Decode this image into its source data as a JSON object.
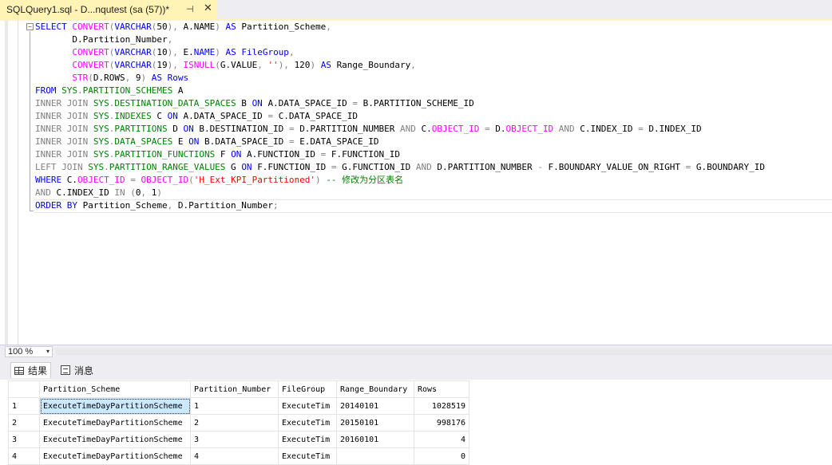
{
  "tab": {
    "title": "SQLQuery1.sql - D...nqutest (sa (57))*",
    "pin_glyph": "⊣",
    "close_glyph": "✕"
  },
  "editor": {
    "fold_glyph": "−",
    "lines": [
      [
        [
          "kw",
          "SELECT "
        ],
        [
          "fn",
          "CONVERT"
        ],
        [
          "gray",
          "("
        ],
        [
          "kw",
          "VARCHAR"
        ],
        [
          "gray",
          "("
        ],
        [
          "id",
          "50"
        ],
        [
          "gray",
          "), "
        ],
        [
          "id",
          "A.NAME"
        ],
        [
          "gray",
          ") "
        ],
        [
          "kw",
          "AS "
        ],
        [
          "id",
          "Partition_Scheme"
        ],
        [
          "gray",
          ","
        ]
      ],
      [
        [
          "id",
          "       D.Partition_Number"
        ],
        [
          "gray",
          ","
        ]
      ],
      [
        [
          "id",
          "       "
        ],
        [
          "fn",
          "CONVERT"
        ],
        [
          "gray",
          "("
        ],
        [
          "kw",
          "VARCHAR"
        ],
        [
          "gray",
          "("
        ],
        [
          "id",
          "10"
        ],
        [
          "gray",
          "), "
        ],
        [
          "id",
          "E."
        ],
        [
          "kw",
          "NAME"
        ],
        [
          "gray",
          ") "
        ],
        [
          "kw",
          "AS "
        ],
        [
          "kw",
          "FileGroup"
        ],
        [
          "gray",
          ","
        ]
      ],
      [
        [
          "id",
          "       "
        ],
        [
          "fn",
          "CONVERT"
        ],
        [
          "gray",
          "("
        ],
        [
          "kw",
          "VARCHAR"
        ],
        [
          "gray",
          "("
        ],
        [
          "id",
          "19"
        ],
        [
          "gray",
          "), "
        ],
        [
          "fn",
          "ISNULL"
        ],
        [
          "gray",
          "("
        ],
        [
          "id",
          "G.VALUE"
        ],
        [
          "gray",
          ", "
        ],
        [
          "str",
          "''"
        ],
        [
          "gray",
          "), "
        ],
        [
          "id",
          "120"
        ],
        [
          "gray",
          ") "
        ],
        [
          "kw",
          "AS "
        ],
        [
          "id",
          "Range_Boundary"
        ],
        [
          "gray",
          ","
        ]
      ],
      [
        [
          "id",
          "       "
        ],
        [
          "fn",
          "STR"
        ],
        [
          "gray",
          "("
        ],
        [
          "id",
          "D.ROWS"
        ],
        [
          "gray",
          ", "
        ],
        [
          "id",
          "9"
        ],
        [
          "gray",
          ") "
        ],
        [
          "kw",
          "AS "
        ],
        [
          "kw",
          "Rows"
        ]
      ],
      [
        [
          "kw",
          "FROM "
        ],
        [
          "sys",
          "SYS"
        ],
        [
          "gray",
          "."
        ],
        [
          "sys",
          "PARTITION_SCHEMES"
        ],
        [
          "id",
          " A"
        ]
      ],
      [
        [
          "gray",
          "INNER JOIN "
        ],
        [
          "sys",
          "SYS"
        ],
        [
          "gray",
          "."
        ],
        [
          "sys",
          "DESTINATION_DATA_SPACES"
        ],
        [
          "id",
          " B "
        ],
        [
          "kw",
          "ON "
        ],
        [
          "id",
          "A.DATA_SPACE_ID "
        ],
        [
          "gray",
          "= "
        ],
        [
          "id",
          "B.PARTITION_SCHEME_ID"
        ]
      ],
      [
        [
          "gray",
          "INNER JOIN "
        ],
        [
          "sys",
          "SYS"
        ],
        [
          "gray",
          "."
        ],
        [
          "sys",
          "INDEXES"
        ],
        [
          "id",
          " C "
        ],
        [
          "kw",
          "ON "
        ],
        [
          "id",
          "A.DATA_SPACE_ID "
        ],
        [
          "gray",
          "= "
        ],
        [
          "id",
          "C.DATA_SPACE_ID"
        ]
      ],
      [
        [
          "gray",
          "INNER JOIN "
        ],
        [
          "sys",
          "SYS"
        ],
        [
          "gray",
          "."
        ],
        [
          "sys",
          "PARTITIONS"
        ],
        [
          "id",
          " D "
        ],
        [
          "kw",
          "ON "
        ],
        [
          "id",
          "B.DESTINATION_ID "
        ],
        [
          "gray",
          "= "
        ],
        [
          "id",
          "D.PARTITION_NUMBER "
        ],
        [
          "gray",
          "AND "
        ],
        [
          "id",
          "C."
        ],
        [
          "fn",
          "OBJECT_ID"
        ],
        [
          "gray",
          " = "
        ],
        [
          "id",
          "D."
        ],
        [
          "fn",
          "OBJECT_ID"
        ],
        [
          "gray",
          " AND "
        ],
        [
          "id",
          "C.INDEX_ID "
        ],
        [
          "gray",
          "= "
        ],
        [
          "id",
          "D.INDEX_ID"
        ]
      ],
      [
        [
          "gray",
          "INNER JOIN "
        ],
        [
          "sys",
          "SYS"
        ],
        [
          "gray",
          "."
        ],
        [
          "sys",
          "DATA_SPACES"
        ],
        [
          "id",
          " E "
        ],
        [
          "kw",
          "ON "
        ],
        [
          "id",
          "B.DATA_SPACE_ID "
        ],
        [
          "gray",
          "= "
        ],
        [
          "id",
          "E.DATA_SPACE_ID"
        ]
      ],
      [
        [
          "gray",
          "INNER JOIN "
        ],
        [
          "sys",
          "SYS"
        ],
        [
          "gray",
          "."
        ],
        [
          "sys",
          "PARTITION_FUNCTIONS"
        ],
        [
          "id",
          " F "
        ],
        [
          "kw",
          "ON "
        ],
        [
          "id",
          "A.FUNCTION_ID "
        ],
        [
          "gray",
          "= "
        ],
        [
          "id",
          "F.FUNCTION_ID"
        ]
      ],
      [
        [
          "gray",
          "LEFT JOIN "
        ],
        [
          "sys",
          "SYS"
        ],
        [
          "gray",
          "."
        ],
        [
          "sys",
          "PARTITION_RANGE_VALUES"
        ],
        [
          "id",
          " G "
        ],
        [
          "kw",
          "ON "
        ],
        [
          "id",
          "F.FUNCTION_ID "
        ],
        [
          "gray",
          "= "
        ],
        [
          "id",
          "G.FUNCTION_ID "
        ],
        [
          "gray",
          "AND "
        ],
        [
          "id",
          "D.PARTITION_NUMBER "
        ],
        [
          "gray",
          "- "
        ],
        [
          "id",
          "F.BOUNDARY_VALUE_ON_RIGHT "
        ],
        [
          "gray",
          "= "
        ],
        [
          "id",
          "G.BOUNDARY_ID"
        ]
      ],
      [
        [
          "kw",
          "WHERE "
        ],
        [
          "id",
          "C."
        ],
        [
          "fn",
          "OBJECT_ID"
        ],
        [
          "gray",
          " = "
        ],
        [
          "fn",
          "OBJECT_ID"
        ],
        [
          "gray",
          "("
        ],
        [
          "str",
          "'H_Ext_KPI_Partitioned'"
        ],
        [
          "gray",
          ") "
        ],
        [
          "cmt",
          "-- 修改为分区表名"
        ]
      ],
      [
        [
          "gray",
          "AND "
        ],
        [
          "id",
          "C.INDEX_ID "
        ],
        [
          "gray",
          "IN "
        ],
        [
          "gray",
          "("
        ],
        [
          "id",
          "0"
        ],
        [
          "gray",
          ", "
        ],
        [
          "id",
          "1"
        ],
        [
          "gray",
          ")"
        ]
      ],
      [
        [
          "kw",
          "ORDER BY "
        ],
        [
          "id",
          "Partition_Scheme"
        ],
        [
          "gray",
          ", "
        ],
        [
          "id",
          "D.Partition_Number"
        ],
        [
          "gray",
          ";"
        ]
      ]
    ]
  },
  "zoom": {
    "value": "100 %",
    "arrow": "▾"
  },
  "results_tabs": {
    "results_label": "结果",
    "messages_label": "消息"
  },
  "results": {
    "columns": [
      "",
      "Partition_Scheme",
      "Partition_Number",
      "FileGroup",
      "Range_Boundary",
      "Rows"
    ],
    "rows": [
      [
        "1",
        "ExecuteTimeDayPartitionScheme",
        "1",
        "ExecuteTim",
        "20140101",
        "1028519"
      ],
      [
        "2",
        "ExecuteTimeDayPartitionScheme",
        "2",
        "ExecuteTim",
        "20150101",
        "998176"
      ],
      [
        "3",
        "ExecuteTimeDayPartitionScheme",
        "3",
        "ExecuteTim",
        "20160101",
        "4"
      ],
      [
        "4",
        "ExecuteTimeDayPartitionScheme",
        "4",
        "ExecuteTim",
        "",
        "0"
      ]
    ]
  },
  "colors": {
    "tab_active": "#fff3b5",
    "keyword": "#0000ff",
    "function": "#ff00ff",
    "system_object": "#008000",
    "operator": "#808080",
    "string": "#ff0000",
    "selection": "#cce8ff"
  }
}
